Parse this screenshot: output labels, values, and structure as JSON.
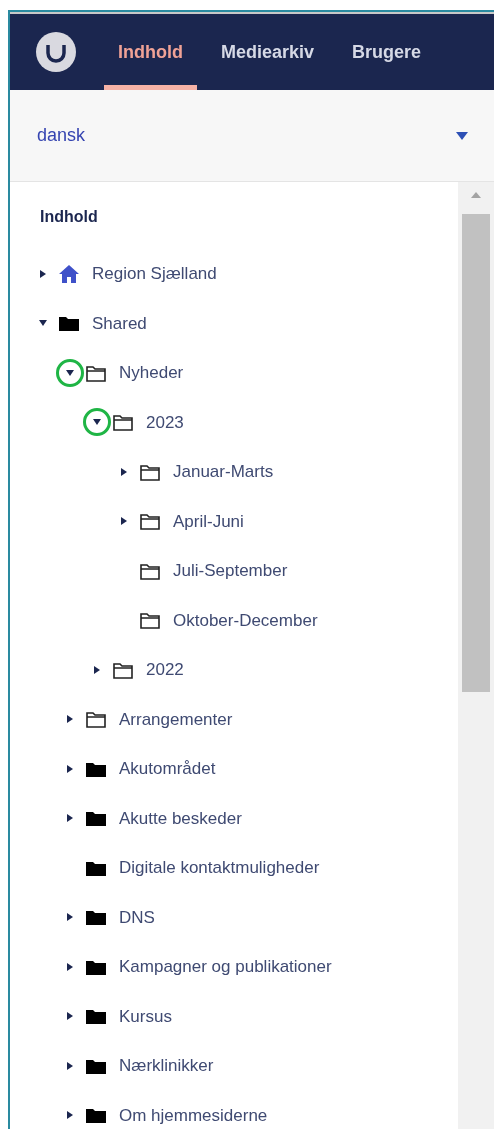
{
  "nav": {
    "tabs": [
      {
        "label": "Indhold",
        "selected": true
      },
      {
        "label": "Mediearkiv",
        "selected": false
      },
      {
        "label": "Brugere",
        "selected": false
      }
    ]
  },
  "language_select": {
    "value": "dansk"
  },
  "tree": {
    "heading": "Indhold",
    "nodes": [
      {
        "label": "Region Sjælland",
        "kind": "home",
        "has_children": true,
        "expanded": false
      },
      {
        "label": "Shared",
        "kind": "folder",
        "has_children": true,
        "expanded": true,
        "children": [
          {
            "label": "Nyheder",
            "kind": "folder-outline",
            "has_children": true,
            "expanded": true,
            "highlighted": true,
            "children": [
              {
                "label": "2023",
                "kind": "folder-outline",
                "has_children": true,
                "expanded": true,
                "highlighted": true,
                "children": [
                  {
                    "label": "Januar-Marts",
                    "kind": "folder-outline",
                    "has_children": true,
                    "expanded": false
                  },
                  {
                    "label": "April-Juni",
                    "kind": "folder-outline",
                    "has_children": true,
                    "expanded": false
                  },
                  {
                    "label": "Juli-September",
                    "kind": "folder-outline",
                    "has_children": false
                  },
                  {
                    "label": "Oktober-December",
                    "kind": "folder-outline",
                    "has_children": false
                  }
                ]
              },
              {
                "label": "2022",
                "kind": "folder-outline",
                "has_children": true,
                "expanded": false
              }
            ]
          },
          {
            "label": "Arrangementer",
            "kind": "folder-outline",
            "has_children": true,
            "expanded": false
          },
          {
            "label": "Akutområdet",
            "kind": "folder",
            "has_children": true,
            "expanded": false
          },
          {
            "label": "Akutte beskeder",
            "kind": "folder",
            "has_children": true,
            "expanded": false
          },
          {
            "label": "Digitale kontaktmuligheder",
            "kind": "folder",
            "has_children": false
          },
          {
            "label": "DNS",
            "kind": "folder",
            "has_children": true,
            "expanded": false
          },
          {
            "label": "Kampagner og publikationer",
            "kind": "folder",
            "has_children": true,
            "expanded": false
          },
          {
            "label": "Kursus",
            "kind": "folder",
            "has_children": true,
            "expanded": false
          },
          {
            "label": "Nærklinikker",
            "kind": "folder",
            "has_children": true,
            "expanded": false
          },
          {
            "label": "Om hjemmesiderne",
            "kind": "folder",
            "has_children": true,
            "expanded": false
          }
        ]
      }
    ]
  }
}
